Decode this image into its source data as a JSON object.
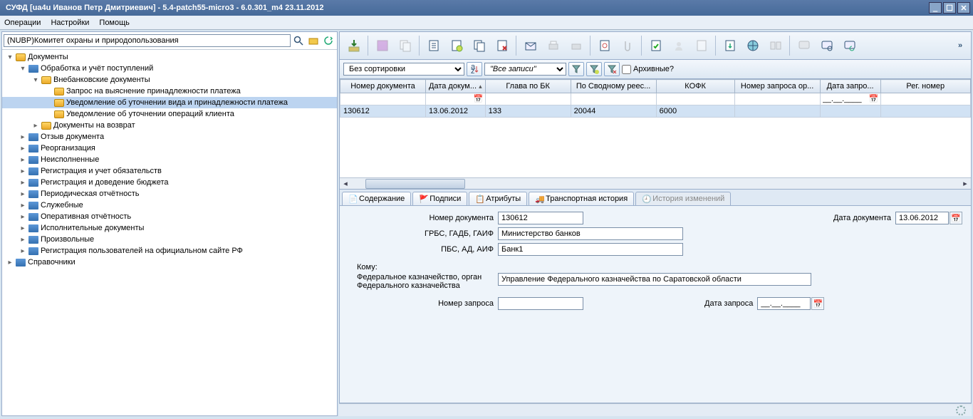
{
  "title": "СУФД [ua4u Иванов Петр Дмитриевич] - 5.4-patch55-micro3 - 6.0.301_m4 23.11.2012",
  "menu": {
    "ops": "Операции",
    "settings": "Настройки",
    "help": "Помощь"
  },
  "search": {
    "value": "(NUBP)Комитет охраны и природопользования"
  },
  "tree": {
    "root": {
      "label": "Документы"
    },
    "n1": {
      "label": "Обработка и учёт поступлений"
    },
    "n1_1": {
      "label": "Внебанковские документы"
    },
    "n1_1_1": {
      "label": "Запрос на выяснение принадлежности платежа"
    },
    "n1_1_2": {
      "label": "Уведомление об уточнении вида и принадлежности платежа"
    },
    "n1_1_3": {
      "label": "Уведомление об уточнении операций клиента"
    },
    "n1_2": {
      "label": "Документы на возврат"
    },
    "n2": {
      "label": "Отзыв документа"
    },
    "n3": {
      "label": "Реорганизация"
    },
    "n4": {
      "label": "Неисполненные"
    },
    "n5": {
      "label": "Регистрация и учет обязательств"
    },
    "n6": {
      "label": "Регистрация и доведение бюджета"
    },
    "n7": {
      "label": "Периодическая отчётность"
    },
    "n8": {
      "label": "Служебные"
    },
    "n9": {
      "label": "Оперативная отчётность"
    },
    "n10": {
      "label": "Исполнительные документы"
    },
    "n11": {
      "label": "Произвольные"
    },
    "n12": {
      "label": "Регистрация пользователей на официальном сайте РФ"
    },
    "ref": {
      "label": "Справочники"
    }
  },
  "filters": {
    "sort": "Без сортировки",
    "all": "\"Все записи\"",
    "archive": "Архивные?"
  },
  "grid": {
    "cols": {
      "docnum": "Номер документа",
      "docdate": "Дата докум...",
      "glava": "Глава по БК",
      "svod": "По Сводному реес...",
      "kofk": "КОФК",
      "reqnum": "Номер запроса ор...",
      "reqdate": "Дата запро...",
      "regnum": "Рег. номер"
    },
    "filterrow": {
      "reqdate": "__.__.____"
    },
    "row": {
      "docnum": "130612",
      "docdate": "13.06.2012",
      "glava": "133",
      "svod": "20044",
      "kofk": "6000",
      "reqnum": "",
      "reqdate": "",
      "regnum": ""
    }
  },
  "tabs": {
    "content": "Содержание",
    "sign": "Подписи",
    "attr": "Атрибуты",
    "transport": "Транспортная история",
    "history": "История изменений"
  },
  "detail": {
    "l_docnum": "Номер документа",
    "v_docnum": "130612",
    "l_docdate": "Дата документа",
    "v_docdate": "13.06.2012",
    "l_grbs": "ГРБС, ГАДБ, ГАИФ",
    "v_grbs": "Министерство банков",
    "l_pbs": "ПБС, АД, АИФ",
    "v_pbs": "Банк1",
    "l_komu": "Кому:",
    "l_fedorg": "Федеральное казначейство, орган Федерального казначейства",
    "v_fedorg": "Управление Федерального казначейства по Саратовской области",
    "l_reqnum": "Номер запроса",
    "v_reqnum": "",
    "l_reqdate": "Дата запроса",
    "v_reqdate": "__.__.____"
  }
}
